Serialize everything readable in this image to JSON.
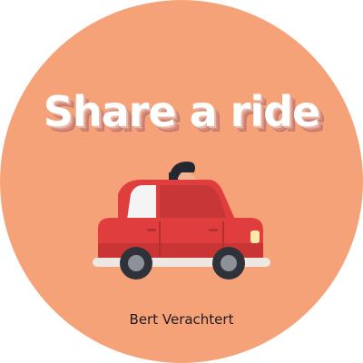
{
  "badge": {
    "title": "Share a ride",
    "author": "Bert Verachtert",
    "colors": {
      "background": "#f6a279",
      "car_body": "#e03e3e",
      "title_text": "#ffffff"
    }
  },
  "icons": {
    "illustration": "car-with-driver-illustration"
  }
}
